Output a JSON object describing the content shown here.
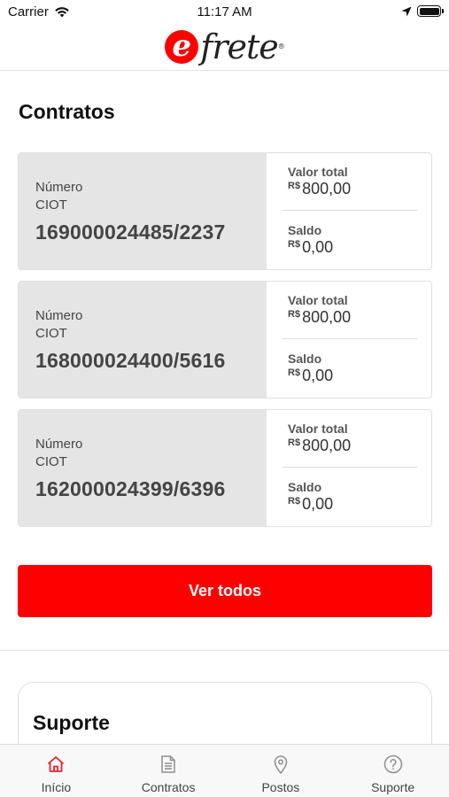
{
  "status_bar": {
    "carrier": "Carrier",
    "time": "11:17 AM"
  },
  "brand": {
    "logo_text": "frete",
    "logo_mark": "e",
    "registered": "®",
    "accent": "#ff0000"
  },
  "contracts": {
    "title": "Contratos",
    "items": [
      {
        "label_line1": "Número",
        "label_line2": "CIOT",
        "number": "169000024485/2237",
        "total_label": "Valor total",
        "currency": "R$",
        "total_value": "800,00",
        "balance_label": "Saldo",
        "balance_value": "0,00"
      },
      {
        "label_line1": "Número",
        "label_line2": "CIOT",
        "number": "168000024400/5616",
        "total_label": "Valor total",
        "currency": "R$",
        "total_value": "800,00",
        "balance_label": "Saldo",
        "balance_value": "0,00"
      },
      {
        "label_line1": "Número",
        "label_line2": "CIOT",
        "number": "162000024399/6396",
        "total_label": "Valor total",
        "currency": "R$",
        "total_value": "800,00",
        "balance_label": "Saldo",
        "balance_value": "0,00"
      }
    ],
    "see_all_label": "Ver todos"
  },
  "support": {
    "title": "Suporte"
  },
  "tabbar": {
    "items": [
      {
        "label": "Início",
        "icon": "home-icon",
        "active": true
      },
      {
        "label": "Contratos",
        "icon": "document-icon",
        "active": false
      },
      {
        "label": "Postos",
        "icon": "location-pin-icon",
        "active": false
      },
      {
        "label": "Suporte",
        "icon": "question-icon",
        "active": false
      }
    ]
  }
}
